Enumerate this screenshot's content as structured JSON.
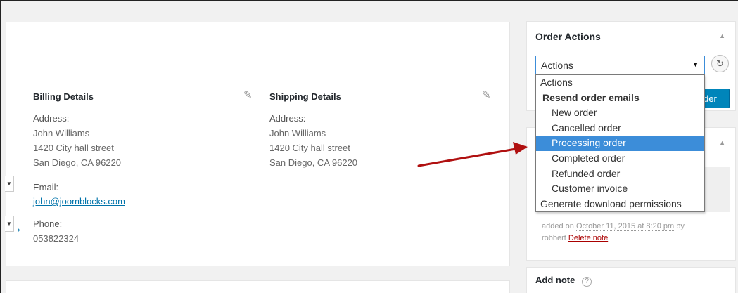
{
  "billing": {
    "title": "Billing Details",
    "address_label": "Address:",
    "address_lines": [
      "John Williams",
      "1420 City hall street",
      "San Diego, CA 96220"
    ],
    "email_label": "Email:",
    "email": "john@joomblocks.com",
    "phone_label": "Phone:",
    "phone": "053822324"
  },
  "shipping": {
    "title": "Shipping Details",
    "address_label": "Address:",
    "address_lines": [
      "John Williams",
      "1420 City hall street",
      "San Diego, CA 96220"
    ]
  },
  "order_actions": {
    "title": "Order Actions",
    "selected": "Actions",
    "update_button_partial": "der",
    "options": [
      {
        "label": "Actions",
        "kind": "option"
      },
      {
        "label": "Resend order emails",
        "kind": "group"
      },
      {
        "label": "New order",
        "kind": "sub"
      },
      {
        "label": "Cancelled order",
        "kind": "sub"
      },
      {
        "label": "Processing order",
        "kind": "sub",
        "highlighted": true
      },
      {
        "label": "Completed order",
        "kind": "sub"
      },
      {
        "label": "Refunded order",
        "kind": "sub"
      },
      {
        "label": "Customer invoice",
        "kind": "sub"
      },
      {
        "label": "Generate download permissions",
        "kind": "option"
      }
    ]
  },
  "order_notes": {
    "added_prefix": "added on",
    "date": "October 11, 2015 at 8:20 pm",
    "by_text": "by",
    "author": "robbert",
    "delete_label": "Delete note"
  },
  "add_note": {
    "title": "Add note"
  },
  "icons": {
    "edit": "pencil-icon",
    "collapse": "triangle-up-icon",
    "refresh": "refresh-icon",
    "help": "question-circle-icon",
    "annotation": "red-arrow"
  },
  "colors": {
    "highlight": "#3c8dd9",
    "link": "#0073aa",
    "primary_button": "#0085ba",
    "delete_link": "#a00000",
    "annotation_arrow": "#b01010"
  }
}
